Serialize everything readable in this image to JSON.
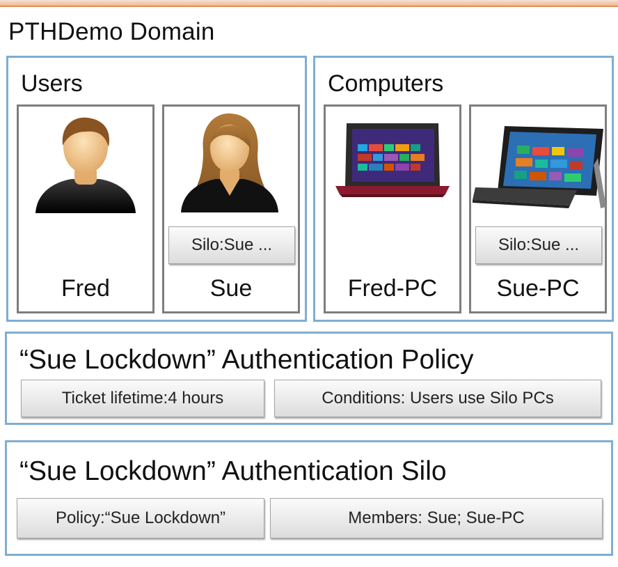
{
  "domain": {
    "title": "PTHDemo Domain"
  },
  "users": {
    "title": "Users",
    "fred": {
      "name": "Fred"
    },
    "sue": {
      "name": "Sue",
      "silo_tag": "Silo:Sue ..."
    }
  },
  "computers": {
    "title": "Computers",
    "fred_pc": {
      "name": "Fred-PC"
    },
    "sue_pc": {
      "name": "Sue-PC",
      "silo_tag": "Silo:Sue ..."
    }
  },
  "policy": {
    "title": "“Sue Lockdown” Authentication Policy",
    "ticket": "Ticket lifetime:4 hours",
    "conditions": "Conditions: Users use Silo PCs"
  },
  "silo": {
    "title": "“Sue Lockdown” Authentication Silo",
    "policy": "Policy:“Sue Lockdown”",
    "members": "Members: Sue; Sue-PC"
  },
  "colors": {
    "group_border": "#7eaed3",
    "card_border": "#7d7d7d",
    "accent_top": "#e0905a"
  },
  "icons": [
    "male-user-icon",
    "female-user-icon",
    "laptop-icon",
    "tablet-icon"
  ]
}
